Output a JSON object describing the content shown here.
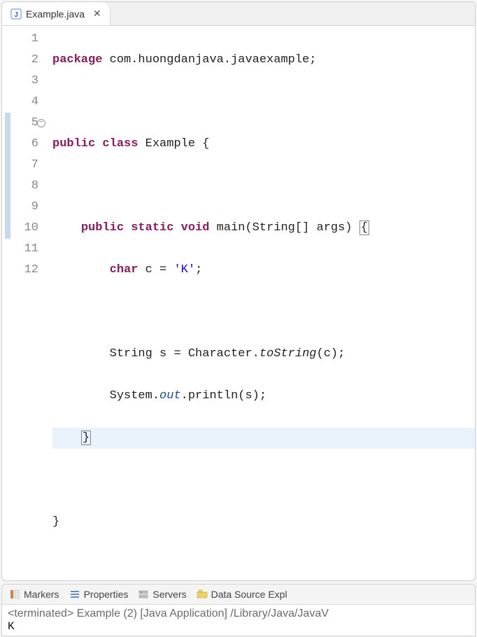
{
  "tab": {
    "filename": "Example.java",
    "close_glyph": "✕"
  },
  "code": {
    "lines": {
      "l1_package": "package",
      "l1_pkg": " com.huongdanjava.javaexample;",
      "l3_public": "public",
      "l3_class": "class",
      "l3_name": " Example {",
      "l5_public": "public",
      "l5_static": "static",
      "l5_void": "void",
      "l5_main": " main(String[] args) ",
      "l5_brace": "{",
      "l6_char": "char",
      "l6_rest": " c = ",
      "l6_lit": "'K'",
      "l6_semi": ";",
      "l8_a": "String s = Character.",
      "l8_m": "toString",
      "l8_b": "(c);",
      "l9_a": "System.",
      "l9_f": "out",
      "l9_b": ".println(s);",
      "l10": "}",
      "l12": "}"
    },
    "line_numbers": [
      "1",
      "2",
      "3",
      "4",
      "5",
      "6",
      "7",
      "8",
      "9",
      "10",
      "11",
      "12"
    ]
  },
  "views": {
    "markers": "Markers",
    "properties": "Properties",
    "servers": "Servers",
    "datasource": "Data Source Expl"
  },
  "console": {
    "status": "<terminated> Example (2) [Java Application] /Library/Java/JavaV",
    "output": "K"
  }
}
